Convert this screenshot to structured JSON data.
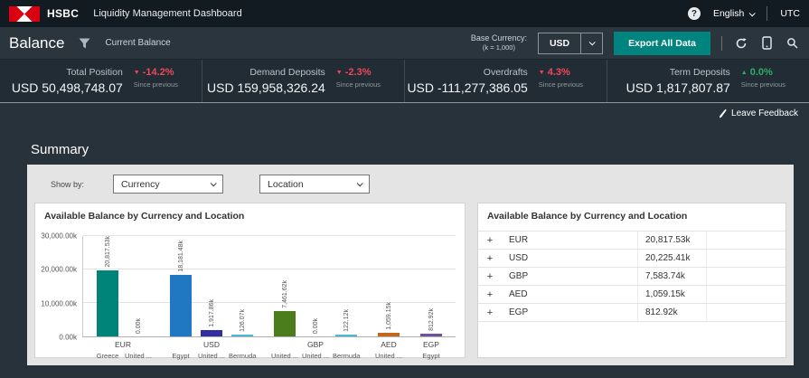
{
  "header": {
    "brand": "HSBC",
    "title": "Liquidity Management Dashboard",
    "help": "?",
    "language": "English",
    "timezone": "UTC"
  },
  "toolbar": {
    "page_title": "Balance",
    "subtitle": "Current Balance",
    "base_currency_label": "Base Currency:",
    "base_currency_note": "(k = 1,000)",
    "base_currency_value": "USD",
    "export_label": "Export All Data"
  },
  "kpis": [
    {
      "label": "Total Position",
      "change": "-14.2%",
      "direction": "down",
      "value": "USD 50,498,748.07",
      "caption": "Since previous"
    },
    {
      "label": "Demand Deposits",
      "change": "-2.3%",
      "direction": "down",
      "value": "USD 159,958,326.24",
      "caption": "Since previous"
    },
    {
      "label": "Overdrafts",
      "change": "4.3%",
      "direction": "down",
      "value": "USD -111,277,386.05",
      "caption": "Since previous"
    },
    {
      "label": "Term Deposits",
      "change": "0.0%",
      "direction": "up",
      "value": "USD 1,817,807.87",
      "caption": "Since previous"
    }
  ],
  "content": {
    "feedback_label": "Leave Feedback",
    "section_title": "Summary",
    "show_by_label": "Show by:",
    "filter_currency": "Currency",
    "filter_location": "Location"
  },
  "chart_data": {
    "type": "bar",
    "title": "Available Balance by Currency and Location",
    "unit": "k",
    "ylim": [
      0,
      30000
    ],
    "grid": true,
    "yticks": [
      {
        "value": 0,
        "label": "0.00k"
      },
      {
        "value": 10000,
        "label": "10,000.00k"
      },
      {
        "value": 20000,
        "label": "20,000.00k"
      },
      {
        "value": 30000,
        "label": "30,000.00k"
      }
    ],
    "groups": [
      {
        "currency": "EUR",
        "bars": [
          {
            "location": "Greece",
            "value": 20817.53,
            "label": "20,817.53k",
            "color": "#00847a"
          },
          {
            "location": "United ...",
            "value": 0,
            "label": "0.00k",
            "color": "#9db3c8"
          }
        ]
      },
      {
        "currency": "USD",
        "bars": [
          {
            "location": "Egypt",
            "value": 18181.48,
            "label": "18,181.48k",
            "color": "#1f78c1"
          },
          {
            "location": "United ...",
            "value": 1917.86,
            "label": "1,917.86k",
            "color": "#33309e"
          },
          {
            "location": "Bermuda",
            "value": 126.07,
            "label": "126.07k",
            "color": "#4ab8d8"
          }
        ]
      },
      {
        "currency": "GBP",
        "bars": [
          {
            "location": "United ...",
            "value": 7461.62,
            "label": "7,461.62k",
            "color": "#4c7d1c"
          },
          {
            "location": "United ...",
            "value": 0,
            "label": "0.00k",
            "color": "#9db3c8"
          },
          {
            "location": "Bermuda",
            "value": 122.12,
            "label": "122.12k",
            "color": "#4ab8d8"
          }
        ]
      },
      {
        "currency": "AED",
        "bars": [
          {
            "location": "United ...",
            "value": 1059.15,
            "label": "1,059.15k",
            "color": "#c4661b"
          }
        ]
      },
      {
        "currency": "EGP",
        "bars": [
          {
            "location": "Egypt",
            "value": 812.92,
            "label": "812.92k",
            "color": "#6f50a1"
          }
        ]
      }
    ]
  },
  "table": {
    "title": "Available Balance by Currency and Location",
    "rows": [
      {
        "expander": "+",
        "currency": "EUR",
        "value": "20,817.53k"
      },
      {
        "expander": "+",
        "currency": "USD",
        "value": "20,225.41k"
      },
      {
        "expander": "+",
        "currency": "GBP",
        "value": "7,583.74k"
      },
      {
        "expander": "+",
        "currency": "AED",
        "value": "1,059.15k"
      },
      {
        "expander": "+",
        "currency": "EGP",
        "value": "812.92k"
      }
    ]
  },
  "colors": {
    "brand_red": "#db0011",
    "accent_teal": "#00847f",
    "negative": "#f0475a",
    "positive": "#2fac66"
  }
}
